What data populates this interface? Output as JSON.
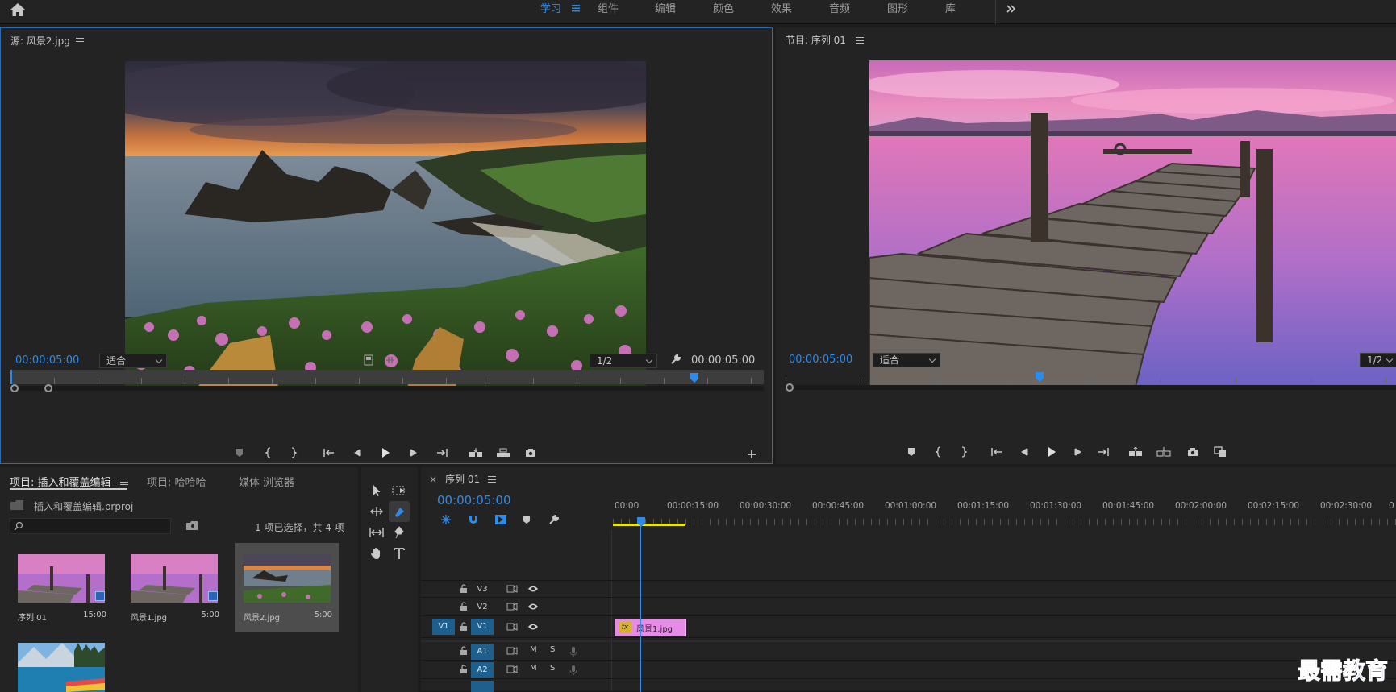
{
  "workspace_tabs": [
    {
      "label": "学习",
      "active": true
    },
    {
      "label": "组件"
    },
    {
      "label": "编辑"
    },
    {
      "label": "颜色"
    },
    {
      "label": "效果"
    },
    {
      "label": "音频"
    },
    {
      "label": "图形"
    },
    {
      "label": "库"
    }
  ],
  "source": {
    "title": "源: 风景2.jpg",
    "timecode_left": "00:00:05:00",
    "fit": "适合",
    "resolution": "1/2",
    "timecode_right": "00:00:05:00"
  },
  "program": {
    "title": "节目: 序列 01",
    "timecode_left": "00:00:05:00",
    "fit": "适合",
    "resolution": "1/2"
  },
  "project": {
    "tabs": [
      "项目: 插入和覆盖编辑",
      "项目: 哈哈哈",
      "媒体 浏览器"
    ],
    "file_name": "插入和覆盖编辑.prproj",
    "search_placeholder": "",
    "selection_info": "1 项已选择，共 4 项",
    "items": [
      {
        "name": "序列 01",
        "duration": "15:00",
        "selected": false
      },
      {
        "name": "风景1.jpg",
        "duration": "5:00",
        "selected": false
      },
      {
        "name": "风景2.jpg",
        "duration": "5:00",
        "selected": true
      },
      {
        "name": "",
        "duration": "",
        "selected": false
      }
    ]
  },
  "timeline": {
    "close_mark": "×",
    "tab": "序列 01",
    "timecode": "00:00:05:00",
    "ruler": [
      "00:00",
      "00:00:15:00",
      "00:00:30:00",
      "00:00:45:00",
      "00:01:00:00",
      "00:01:15:00",
      "00:01:30:00",
      "00:01:45:00",
      "00:02:00:00",
      "00:02:15:00",
      "00:02:30:00",
      "0"
    ],
    "tracks": {
      "v3": "V3",
      "v2": "V2",
      "v1_src": "V1",
      "v1": "V1",
      "a1": "A1",
      "a2": "A2",
      "mute": "M",
      "solo": "S"
    },
    "clip": {
      "fx": "fx",
      "name": "风景1.jpg"
    }
  },
  "watermark": "最需教育",
  "colors": {
    "accent": "#2d8ceb",
    "clip": "#e58ce6",
    "track_on": "#1f5f8e"
  }
}
